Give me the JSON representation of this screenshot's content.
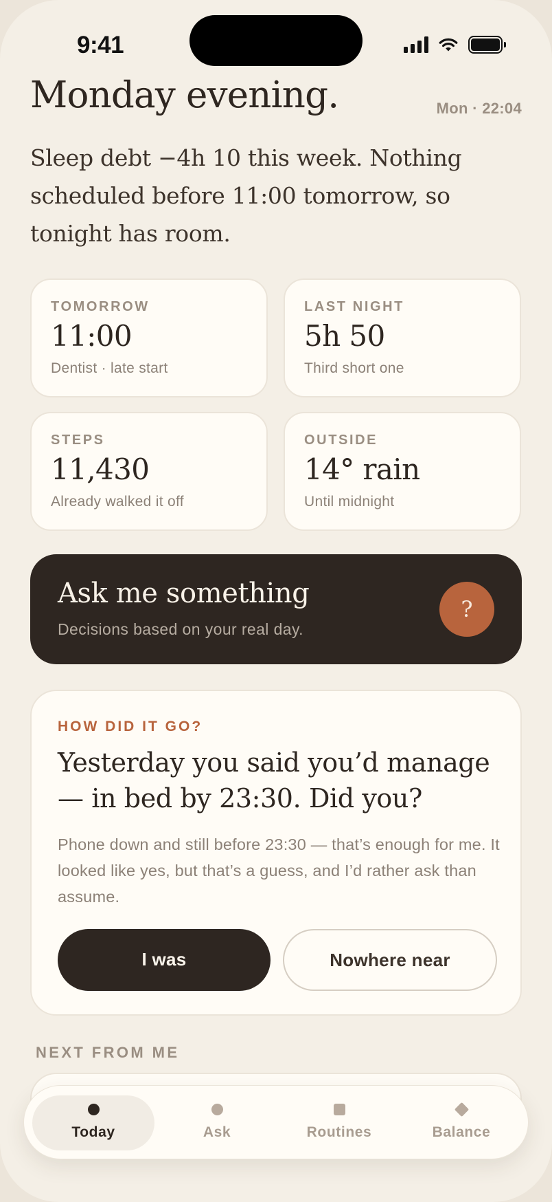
{
  "status_bar": {
    "time": "9:41"
  },
  "header": {
    "greeting": "Monday evening.",
    "datetime": "Mon · 22:04",
    "intro": "Sleep debt −4h 10 this week. Nothing scheduled before 11:00 tomorrow, so tonight has room."
  },
  "stats": [
    {
      "label": "TOMORROW",
      "value": "11:00",
      "note": "Dentist · late start"
    },
    {
      "label": "LAST NIGHT",
      "value": "5h 50",
      "note": "Third short one"
    },
    {
      "label": "STEPS",
      "value": "11,430",
      "note": "Already walked it off"
    },
    {
      "label": "OUTSIDE",
      "value": "14° rain",
      "note": "Until midnight"
    }
  ],
  "ask": {
    "title": "Ask me something",
    "subtitle": "Decisions based on your real day.",
    "button_glyph": "?"
  },
  "checkin": {
    "label": "HOW DID IT GO?",
    "question": "Yesterday you said you’d manage — in bed by 23:30. Did you?",
    "body": "Phone down and still before 23:30 — that’s enough for me. It looked like yes, but that’s a guess, and I’d rather ask than assume.",
    "yes_label": "I was",
    "no_label": "Nowhere near"
  },
  "next_section": {
    "label": "NEXT FROM ME"
  },
  "tabs": [
    {
      "label": "Today",
      "icon": "dot-icon",
      "active": true
    },
    {
      "label": "Ask",
      "icon": "dot-icon",
      "active": false
    },
    {
      "label": "Routines",
      "icon": "square-icon",
      "active": false
    },
    {
      "label": "Balance",
      "icon": "diamond-icon",
      "active": false
    }
  ],
  "colors": {
    "background": "#f4efe6",
    "card": "#fffcf6",
    "ink": "#2e2620",
    "accent": "#b8643d",
    "muted": "#9a8e82"
  }
}
